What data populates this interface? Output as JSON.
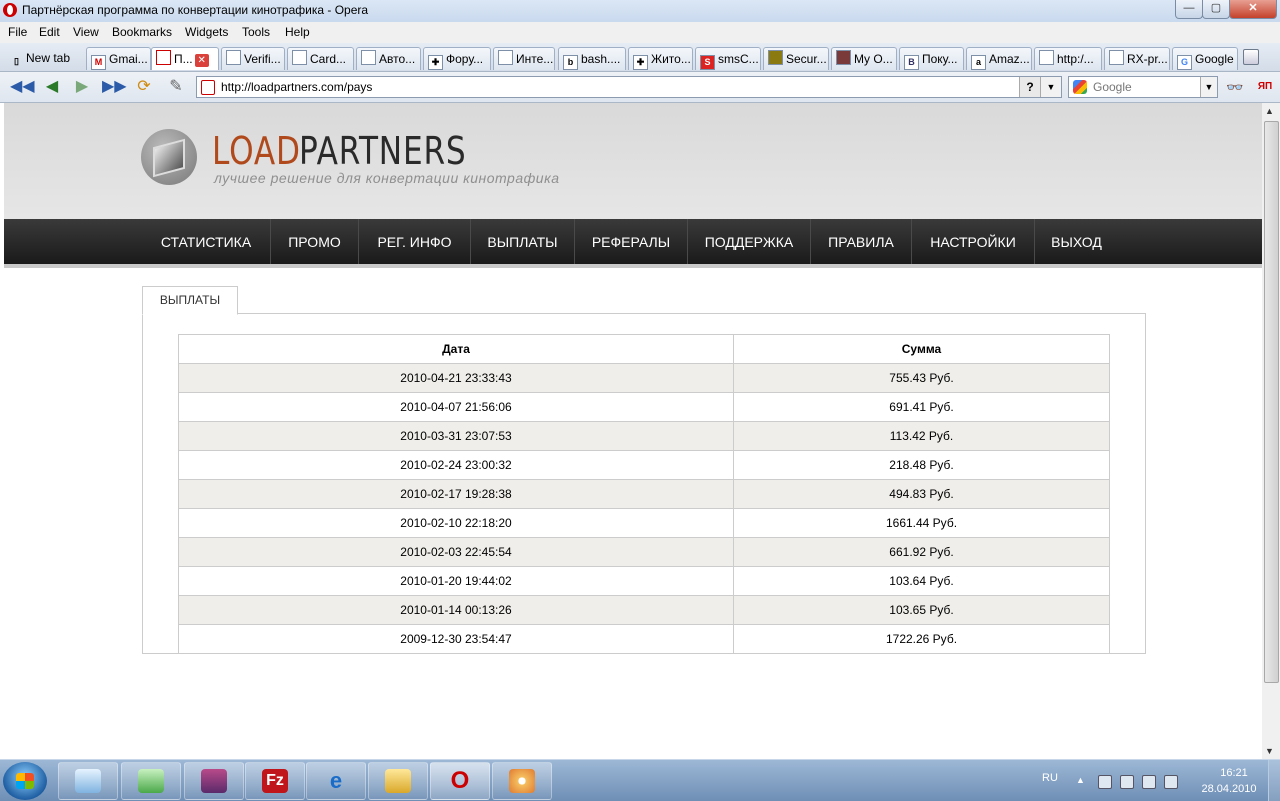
{
  "window": {
    "title": "Партнёрская программа по конвертации кинотрафика - Opera"
  },
  "menu": [
    "File",
    "Edit",
    "View",
    "Bookmarks",
    "Widgets",
    "Tools",
    "Help"
  ],
  "tabs": [
    {
      "label": "New tab",
      "icon": "new-tab-icon"
    },
    {
      "label": "Gmai...",
      "icon": "gmail-icon"
    },
    {
      "label": "П...",
      "icon": "page-icon",
      "active": true
    },
    {
      "label": "Verifi...",
      "icon": "page-icon"
    },
    {
      "label": "Card...",
      "icon": "page-icon"
    },
    {
      "label": "Авто...",
      "icon": "page-icon"
    },
    {
      "label": "Фору...",
      "icon": "page-icon"
    },
    {
      "label": "Инте...",
      "icon": "page-icon"
    },
    {
      "label": "bash....",
      "icon": "bash-icon"
    },
    {
      "label": "Жито...",
      "icon": "page-icon"
    },
    {
      "label": "smsC...",
      "icon": "sms-icon"
    },
    {
      "label": "Secur...",
      "icon": "page-icon"
    },
    {
      "label": "My O...",
      "icon": "page-icon"
    },
    {
      "label": "Поку...",
      "icon": "page-icon"
    },
    {
      "label": "Amaz...",
      "icon": "amazon-icon"
    },
    {
      "label": "http:/...",
      "icon": "page-icon"
    },
    {
      "label": "RX-pr...",
      "icon": "page-icon"
    },
    {
      "label": "Google",
      "icon": "google-icon"
    }
  ],
  "address": {
    "url": "http://loadpartners.com/pays",
    "help_label": "?"
  },
  "search": {
    "engine": "Google"
  },
  "site": {
    "logo_load": "LOAD",
    "logo_partners": "PARTNERS",
    "tagline": "лучшее решение для конвертации кинотрафика",
    "nav": [
      "СТАТИСТИКА",
      "ПРОМО",
      "РЕГ. ИНФО",
      "ВЫПЛАТЫ",
      "РЕФЕРАЛЫ",
      "ПОДДЕРЖКА",
      "ПРАВИЛА",
      "НАСТРОЙКИ",
      "ВЫХОД"
    ],
    "panel_tab": "ВЫПЛАТЫ",
    "table": {
      "headers": [
        "Дата",
        "Сумма"
      ],
      "rows": [
        [
          "2010-04-21 23:33:43",
          "755.43 Руб."
        ],
        [
          "2010-04-07 21:56:06",
          "691.41 Руб."
        ],
        [
          "2010-03-31 23:07:53",
          "113.42 Руб."
        ],
        [
          "2010-02-24 23:00:32",
          "218.48 Руб."
        ],
        [
          "2010-02-17 19:28:38",
          "494.83 Руб."
        ],
        [
          "2010-02-10 22:18:20",
          "1661.44 Руб."
        ],
        [
          "2010-02-03 22:45:54",
          "661.92 Руб."
        ],
        [
          "2010-01-20 19:44:02",
          "103.64 Руб."
        ],
        [
          "2010-01-14 00:13:26",
          "103.65 Руб."
        ],
        [
          "2009-12-30 23:54:47",
          "1722.26 Руб."
        ]
      ]
    }
  },
  "taskbar": {
    "lang": "RU",
    "time": "16:21",
    "date": "28.04.2010"
  },
  "colors": {
    "logo_load": "#b04a1d",
    "navbar": "#1f1f1f",
    "row_alt": "#efeeea"
  }
}
